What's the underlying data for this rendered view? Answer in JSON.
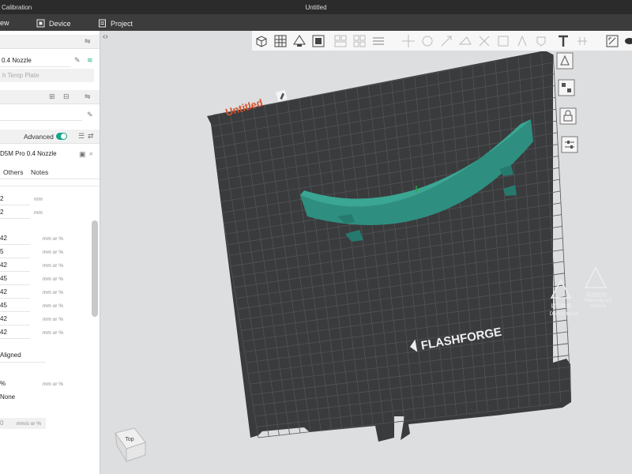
{
  "titlebar": {
    "left_text": "Calibration",
    "center_title": "Untitled"
  },
  "menu": {
    "view": "ew",
    "device": "Device",
    "project": "Project"
  },
  "sidebar": {
    "printer_nozzle": "0.4 Nozzle",
    "plate_placeholder": "h Temp Plate",
    "advanced_label": "Advanced",
    "profile_name": "D5M Pro 0.4 Nozzle",
    "tabs": [
      "Others",
      "Notes"
    ],
    "rows": [
      {
        "value": "2",
        "unit": "mm"
      },
      {
        "value": "2",
        "unit": "mm"
      },
      {
        "value": "42",
        "unit": "mm or %"
      },
      {
        "value": "5",
        "unit": "mm or %"
      },
      {
        "value": "42",
        "unit": "mm or %"
      },
      {
        "value": "45",
        "unit": "mm or %"
      },
      {
        "value": "42",
        "unit": "mm or %"
      },
      {
        "value": "45",
        "unit": "mm or %"
      },
      {
        "value": "42",
        "unit": "mm or %"
      },
      {
        "value": "42",
        "unit": "mm or %"
      }
    ],
    "seam": "Aligned",
    "pct_row": {
      "value": "%",
      "unit": "mm or %"
    },
    "none_row": "None",
    "speed_row": {
      "value": "0",
      "unit": "mm/s or %"
    }
  },
  "plate": {
    "label": "Untitled",
    "brand": "FLASHFORGE",
    "warn1_cn": "请勿触摸",
    "warn1_en": "Do not touch",
    "warn2_cn": "高温危险",
    "warn2_en_1": "Warning hot",
    "warn2_en_2": "surface"
  },
  "viewcube": {
    "face": "Top"
  },
  "colors": {
    "model": "#2f8f7f",
    "bed": "#3a3b3d",
    "grid": "#4f5053",
    "accent": "#17a38e"
  }
}
